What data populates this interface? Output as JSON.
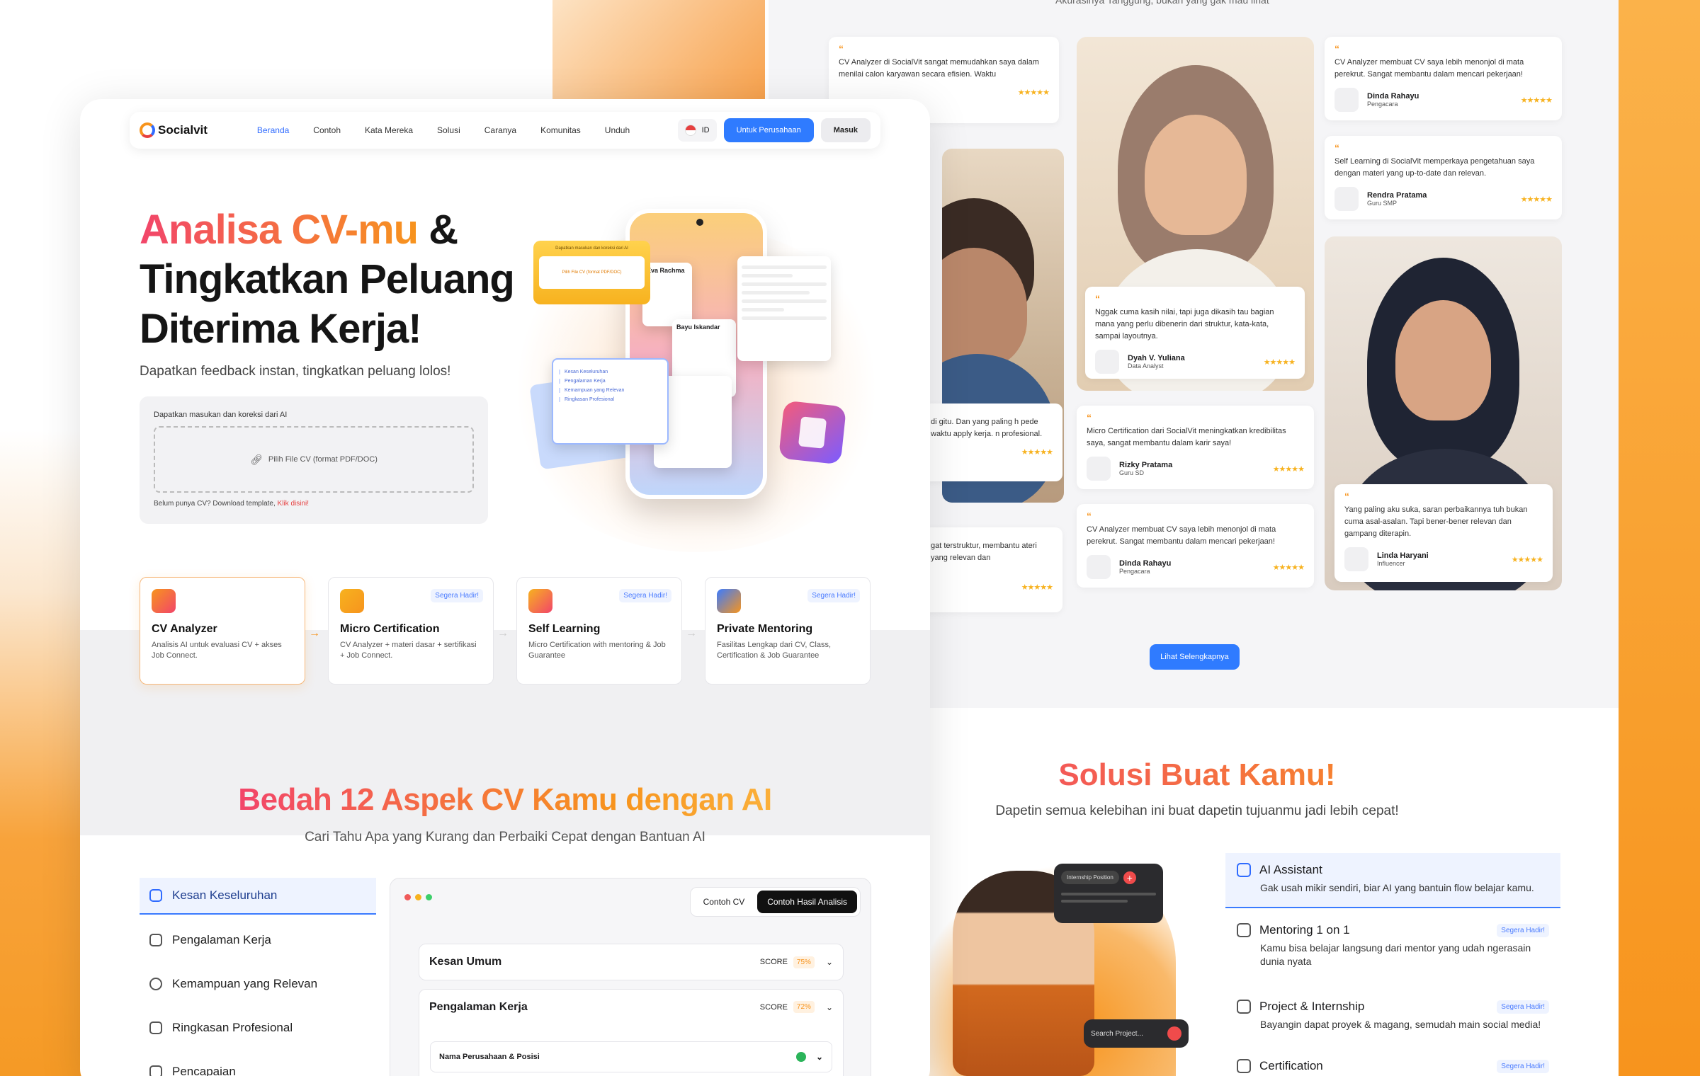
{
  "nav": {
    "brand": "Socialvit",
    "items": [
      "Beranda",
      "Contoh",
      "Kata Mereka",
      "Solusi",
      "Caranya",
      "Komunitas",
      "Unduh"
    ],
    "lang": "ID",
    "cta_company": "Untuk Perusahaan",
    "login": "Masuk"
  },
  "hero": {
    "line1_a": "Analisa CV-mu",
    "line1_b": " &",
    "line2": "Tingkatkan Peluang",
    "line3": "Diterima Kerja!",
    "subtitle": "Dapatkan feedback instan, tingkatkan peluang lolos!",
    "upload_title": "Dapatkan masukan dan koreksi dari AI",
    "upload_button": "Pilih File CV (format PDF/DOC)",
    "template_note": "Belum punya CV? Download template, ",
    "template_link": "Klik disini!"
  },
  "mockup": {
    "card_title": "Dapatkan masukan dan koreksi dari AI",
    "card_button": "Pilih File CV (format PDF/DOC)",
    "list": [
      "Kesan Keseluruhan",
      "Pengalaman Kerja",
      "Kemampuan yang Relevan",
      "Ringkasan Profesional"
    ],
    "cv_name_1": "Eva Rachma",
    "cv_name_2": "Bayu Iskandar"
  },
  "features": [
    {
      "title": "CV Analyzer",
      "desc": "Analisis AI untuk evaluasi CV + akses Job Connect.",
      "badge": ""
    },
    {
      "title": "Micro Certification",
      "desc": "CV Analyzer + materi dasar + sertifikasi + Job Connect.",
      "badge": "Segera Hadir!"
    },
    {
      "title": "Self Learning",
      "desc": "Micro Certification with mentoring & Job Guarantee",
      "badge": "Segera Hadir!"
    },
    {
      "title": "Private Mentoring",
      "desc": "Fasilitas Lengkap dari CV, Class, Certification & Job Guarantee",
      "badge": "Segera Hadir!"
    }
  ],
  "aspects": {
    "title_a": "Bedah 12 Aspek CV Kamu",
    "title_b": " dengan AI",
    "subtitle": "Cari Tahu Apa yang Kurang dan Perbaiki Cepat dengan Bantuan AI",
    "menu": [
      "Kesan Keseluruhan",
      "Pengalaman Kerja",
      "Kemampuan yang Relevan",
      "Ringkasan Profesional",
      "Pencapaian"
    ],
    "tabs": [
      "Contoh CV",
      "Contoh Hasil Analisis"
    ],
    "score_label": "SCORE",
    "rows": [
      {
        "title": "Kesan Umum",
        "score": "75%"
      },
      {
        "title": "Pengalaman Kerja",
        "score": "72%"
      }
    ],
    "subrow": "Nama Perusahaan & Posisi"
  },
  "testimonials": {
    "header": "Akurasinya Tanggung, bukan yang gak mau lihat",
    "cards": [
      {
        "text": "CV Analyzer di SocialVit sangat memudahkan saya dalam menilai calon karyawan secara efisien. Waktu",
        "name": "",
        "role": ""
      },
      {
        "text": "Nggak cuma kasih nilai, tapi juga dikasih tau bagian mana yang perlu dibenerin  dari struktur, kata-kata, sampai layoutnya.",
        "name": "Dyah V. Yuliana",
        "role": "Data Analyst"
      },
      {
        "text": "CV Analyzer membuat CV saya lebih menonjol di mata perekrut. Sangat membantu dalam mencari pekerjaan!",
        "name": "Dinda Rahayu",
        "role": "Pengacara"
      },
      {
        "text": "Self Learning di SocialVit memperkaya pengetahuan saya dengan materi yang up-to-date dan relevan.",
        "name": "Rendra Pratama",
        "role": "Guru SMP"
      },
      {
        "text": "Micro Certification dari SocialVit meningkatkan kredibilitas saya, sangat membantu dalam karir saya!",
        "name": "Rizky Pratama",
        "role": "Guru SD"
      },
      {
        "text": "CV Analyzer membuat CV saya lebih menonjol di mata perekrut. Sangat membantu dalam mencari pekerjaan!",
        "name": "Dinda Rahayu",
        "role": "Pengacara"
      },
      {
        "text": "Yang paling aku suka, saran perbaikannya tuh bukan cuma asal-asalan. Tapi bener-bener relevan dan gampang diterapin.",
        "name": "Linda Haryani",
        "role": "Influencer"
      }
    ],
    "partial_1": "di gitu. Dan yang paling h pede waktu apply kerja. n profesional.",
    "partial_2": "gat terstruktur, membantu ateri yang relevan dan",
    "stars": "★★★★★",
    "more": "Lihat Selengkapnya"
  },
  "solusi": {
    "title": "Solusi Buat Kamu!",
    "subtitle": "Dapetin semua kelebihan ini buat dapetin tujuanmu jadi lebih cepat!",
    "items": [
      {
        "title": "AI Assistant",
        "desc": "Gak usah mikir sendiri, biar AI yang bantuin flow belajar kamu.",
        "badge": ""
      },
      {
        "title": "Mentoring 1 on 1",
        "desc": "Kamu bisa belajar langsung dari mentor yang udah ngerasain dunia nyata",
        "badge": "Segera Hadir!"
      },
      {
        "title": "Project & Internship",
        "desc": "Bayangin dapat proyek & magang, semudah main social media!",
        "badge": "Segera Hadir!"
      },
      {
        "title": "Certification",
        "desc": "",
        "badge": "Segera Hadir!"
      }
    ],
    "internship_label": "Internship Position",
    "search_placeholder": "Search Project..."
  }
}
